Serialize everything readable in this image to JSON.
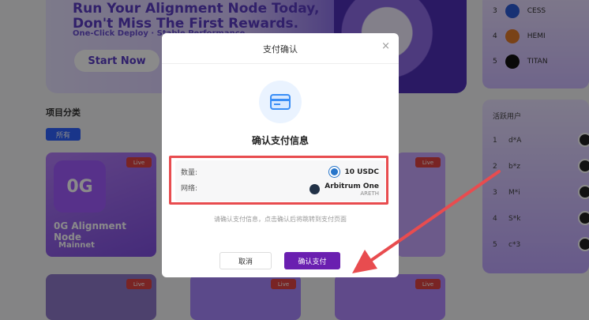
{
  "hero": {
    "title": "Run Your Alignment Node Today, Don't Miss The First Rewards.",
    "subtitle": "One-Click Deploy · Stable Performance",
    "start_button": "Start Now"
  },
  "categories": {
    "label": "项目分类",
    "chip": "所有"
  },
  "cards": [
    {
      "name": "0G Alignment Node",
      "tag": "Mainnet",
      "live": "Live",
      "logo": "0G"
    },
    {
      "live": "Live"
    },
    {
      "live": "Live"
    },
    {
      "live": "Live"
    },
    {
      "live": "Live"
    }
  ],
  "ranking": [
    {
      "idx": "3",
      "name": "CESS"
    },
    {
      "idx": "4",
      "name": "HEMI"
    },
    {
      "idx": "5",
      "name": "TITAN"
    }
  ],
  "active_users": {
    "title": "活跃用户",
    "rows": [
      {
        "idx": "1",
        "name": "d*A"
      },
      {
        "idx": "2",
        "name": "b*z"
      },
      {
        "idx": "3",
        "name": "M*i"
      },
      {
        "idx": "4",
        "name": "S*k"
      },
      {
        "idx": "5",
        "name": "c*3"
      }
    ]
  },
  "modal": {
    "title": "支付确认",
    "close": "×",
    "heading": "确认支付信息",
    "amount_label": "数量:",
    "amount_value": "10 USDC",
    "network_label": "网络:",
    "network_name": "Arbitrum One",
    "network_code": "ARETH",
    "hint": "请确认支付信息，点击确认后将跳转到支付页面",
    "cancel": "取消",
    "confirm": "确认支付"
  },
  "colors": {
    "accent": "#6a1fb0",
    "highlight": "#e84c4f",
    "chip": "#2f62ff"
  }
}
